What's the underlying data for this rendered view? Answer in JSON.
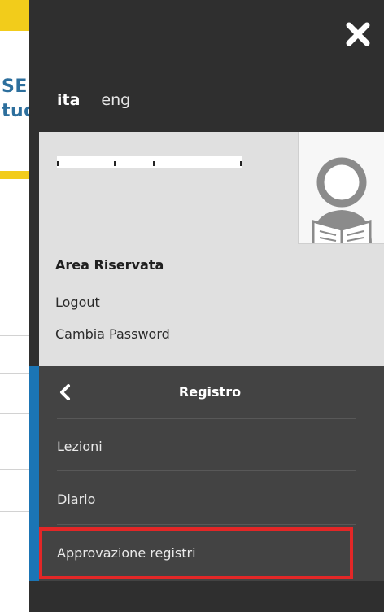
{
  "background_page": {
    "header_fragment_line1": "SE",
    "header_fragment_line2": "tuc"
  },
  "close_button": {
    "icon": "close-icon"
  },
  "languages": [
    {
      "label": "ita",
      "active": true
    },
    {
      "label": "eng",
      "active": false
    }
  ],
  "user_area": {
    "username_redacted": true,
    "avatar_icon": "reader-avatar-icon",
    "section_title": "Area Riservata",
    "links": {
      "logout": "Logout",
      "change_password": "Cambia Password"
    }
  },
  "submenu": {
    "back_icon": "chevron-left-icon",
    "title": "Registro",
    "items": [
      {
        "label": "Lezioni"
      },
      {
        "label": "Diario"
      },
      {
        "label": "Approvazione registri",
        "highlighted": true
      }
    ]
  },
  "colors": {
    "panel_bg": "#2f2f2f",
    "submenu_bg": "#434343",
    "accent_blue": "#1b75b5",
    "highlight_red": "#e32727",
    "brand_yellow": "#f2cc1b",
    "user_area_bg": "#e0e0e0"
  }
}
